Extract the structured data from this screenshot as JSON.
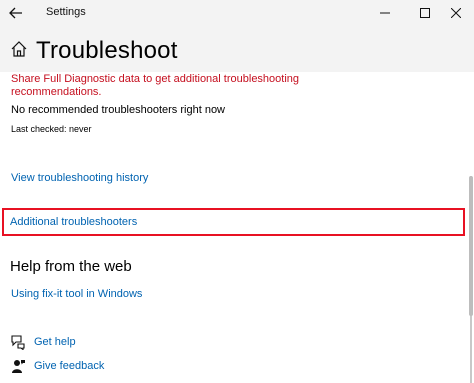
{
  "window": {
    "title": "Settings",
    "controls": {
      "minimize": "—",
      "maximize": "☐",
      "close": "✕"
    }
  },
  "page": {
    "title": "Troubleshoot"
  },
  "content": {
    "warning": "Share Full Diagnostic data to get additional troubleshooting recommendations.",
    "status": "No recommended troubleshooters right now",
    "last_checked": "Last checked: never",
    "view_history_link": "View troubleshooting history",
    "additional_link": "Additional troubleshooters",
    "help_heading": "Help from the web",
    "fixit_link": "Using fix-it tool in Windows",
    "get_help_link": "Get help",
    "feedback_link": "Give feedback"
  },
  "colors": {
    "accent_link": "#0063b1",
    "warning_text": "#c50f1f",
    "highlight_border": "#e81123"
  },
  "icons": [
    "back-arrow-icon",
    "home-icon",
    "get-help-icon",
    "feedback-icon"
  ]
}
